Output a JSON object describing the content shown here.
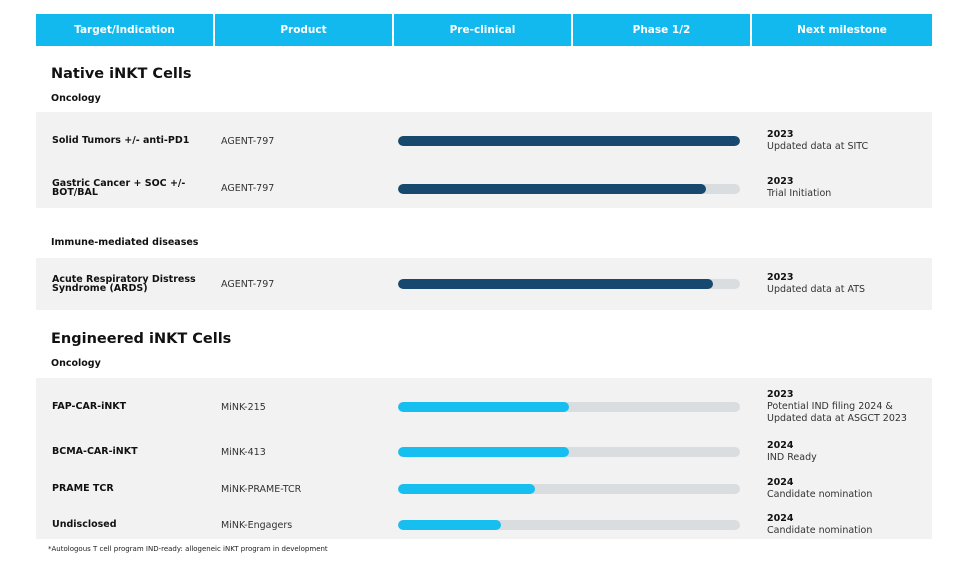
{
  "colors": {
    "header_bg": "#12b9ee",
    "bar_native": "#17486d",
    "bar_engineered": "#16bff0",
    "bar_track": "#dadde0",
    "band_bg": "#f2f2f2"
  },
  "header": {
    "columns": [
      {
        "label": "Target/Indication"
      },
      {
        "label": "Product"
      },
      {
        "label": "Pre-clinical"
      },
      {
        "label": "Phase 1/2"
      },
      {
        "label": "Next milestone"
      }
    ]
  },
  "native": {
    "title": "Native iNKT Cells",
    "oncology_label": "Oncology",
    "immune_label": "Immune-mediated diseases",
    "rows": [
      {
        "target": "Solid Tumors +/- anti-PD1",
        "product": "AGENT-797",
        "progress": 1.0,
        "milestone_year": "2023",
        "milestone_text": "Updated data at SITC"
      },
      {
        "target": "Gastric Cancer + SOC +/- BOT/BAL",
        "product": "AGENT-797",
        "progress": 0.9,
        "milestone_year": "2023",
        "milestone_text": "Trial Initiation"
      },
      {
        "target": "Acute Respiratory Distress Syndrome (ARDS)",
        "product": "AGENT-797",
        "progress": 0.92,
        "milestone_year": "2023",
        "milestone_text": "Updated data at ATS"
      }
    ]
  },
  "engineered": {
    "title": "Engineered iNKT Cells",
    "oncology_label": "Oncology",
    "rows": [
      {
        "target": "FAP-CAR-iNKT",
        "product": "MiNK-215",
        "progress": 0.5,
        "milestone_year": "2023",
        "milestone_text": "Potential IND filing 2024 &",
        "milestone_text_2": "Updated data at ASGCT 2023"
      },
      {
        "target": "BCMA-CAR-iNKT",
        "product": "MiNK-413",
        "progress": 0.5,
        "milestone_year": "2024",
        "milestone_text": "IND Ready"
      },
      {
        "target": "PRAME TCR",
        "product": "MiNK-PRAME-TCR",
        "progress": 0.4,
        "milestone_year": "2024",
        "milestone_text": "Candidate nomination"
      },
      {
        "target": "Undisclosed",
        "product": "MiNK-Engagers",
        "progress": 0.3,
        "milestone_year": "2024",
        "milestone_text": "Candidate nomination"
      }
    ]
  },
  "footnote": "*Autologous T cell program IND-ready: allogeneic iNKT program in development"
}
